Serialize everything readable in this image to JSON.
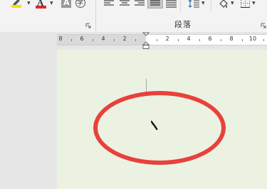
{
  "ribbon": {
    "paragraph_group_label": "段落",
    "phonetic_glyph": "字",
    "char_shading_glyph": "A",
    "font_color_glyph": "A",
    "highlight_color": "#f6e100",
    "font_color": "#d32f2f"
  },
  "ruler": {
    "left_labels": [
      "8",
      "6",
      "4",
      "2"
    ],
    "right_labels": [
      "2",
      "4",
      "6",
      "8",
      "10"
    ]
  },
  "document": {
    "highlight_mark_color": "#e8413c"
  }
}
